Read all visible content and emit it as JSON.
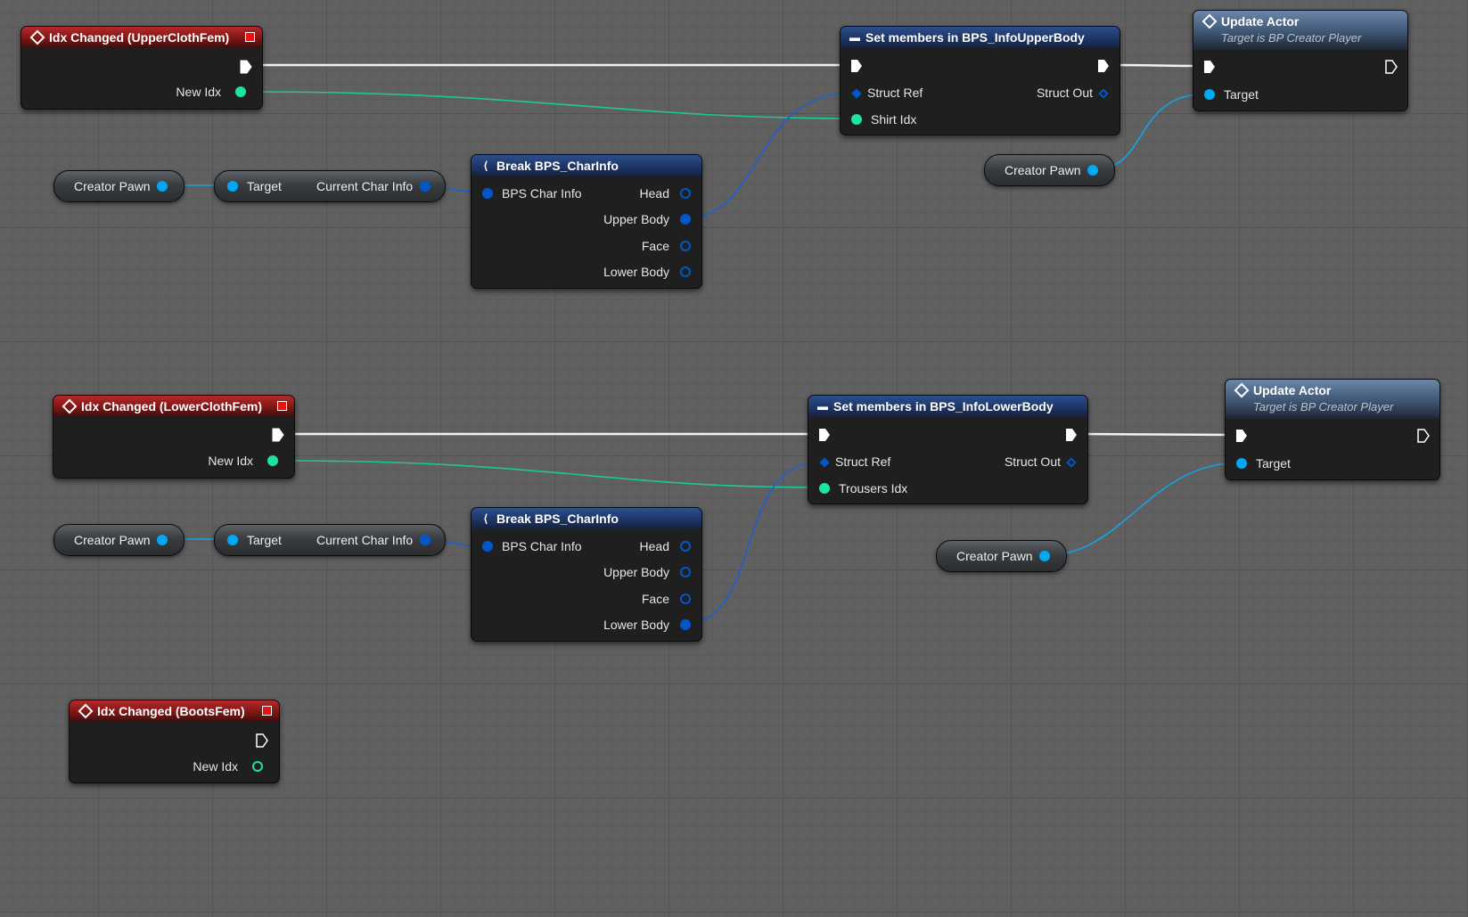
{
  "events": {
    "upper": {
      "title": "Idx Changed (UpperClothFem)",
      "new_idx_label": "New Idx"
    },
    "lower": {
      "title": "Idx Changed (LowerClothFem)",
      "new_idx_label": "New Idx"
    },
    "boots": {
      "title": "Idx Changed (BootsFem)",
      "new_idx_label": "New Idx"
    }
  },
  "set_upper": {
    "title": "Set members in BPS_InfoUpperBody",
    "struct_ref": "Struct Ref",
    "struct_out": "Struct Out",
    "member": "Shirt Idx"
  },
  "set_lower": {
    "title": "Set members in BPS_InfoLowerBody",
    "struct_ref": "Struct Ref",
    "struct_out": "Struct Out",
    "member": "Trousers Idx"
  },
  "update_upper": {
    "title": "Update Actor",
    "subtitle": "Target is BP Creator Player",
    "target": "Target"
  },
  "update_lower": {
    "title": "Update Actor",
    "subtitle": "Target is BP Creator Player",
    "target": "Target"
  },
  "break_upper": {
    "title": "Break BPS_CharInfo",
    "input": "BPS Char Info",
    "outputs": [
      "Head",
      "Upper Body",
      "Face",
      "Lower Body"
    ]
  },
  "break_lower": {
    "title": "Break BPS_CharInfo",
    "input": "BPS Char Info",
    "outputs": [
      "Head",
      "Upper Body",
      "Face",
      "Lower Body"
    ]
  },
  "getter_upper": {
    "target": "Target",
    "output": "Current Char Info"
  },
  "getter_lower": {
    "target": "Target",
    "output": "Current Char Info"
  },
  "vars": {
    "creator_pawn_1": "Creator Pawn",
    "creator_pawn_2": "Creator Pawn",
    "creator_pawn_3": "Creator Pawn",
    "creator_pawn_4": "Creator Pawn"
  },
  "colors": {
    "exec_wire": "#ffffff",
    "int_pin": "#1ee3a0",
    "object_pin": "#00a8f4",
    "struct_pin": "#0058c8",
    "event_header": "#8a1a1a",
    "function_header": "#4a6484",
    "struct_header": "#1d3566"
  }
}
